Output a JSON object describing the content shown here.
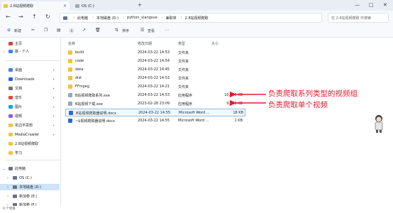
{
  "window": {
    "active_tab": "2.8站视频爬取",
    "inactive_tab": "OS (C:)",
    "controls": [
      "—",
      "□",
      "✕"
    ]
  },
  "address": {
    "crumbs": [
      "此电脑",
      "本地磁盘 (D:)",
      "python_xiangsue",
      "兼职单",
      "2.8站视频爬取"
    ],
    "search_placeholder": "在 2.8站视频爬取 中搜索"
  },
  "toolbar": {
    "new_label": "新建",
    "sort_label": "排序",
    "view_label": "查看"
  },
  "sidebar": {
    "items": [
      {
        "label": "主页",
        "color": "#e23b3b"
      },
      {
        "label": "晨 - 个人",
        "color": "#3b82f6"
      },
      {
        "label": "桌面",
        "color": "#3b82f6"
      },
      {
        "label": "Downloads",
        "color": "#2563eb"
      },
      {
        "label": "文档",
        "color": "#6b7280"
      },
      {
        "label": "音乐",
        "color": "#ef4444"
      },
      {
        "label": "图片",
        "color": "#0ea5e9"
      },
      {
        "label": "视频",
        "color": "#8b5cf6"
      },
      {
        "label": "花边平思想",
        "color": "#f5c23c"
      },
      {
        "label": "MediaCrawler",
        "color": "#f5c23c"
      },
      {
        "label": "2.8站视频爬取",
        "color": "#f5c23c"
      },
      {
        "label": "学习",
        "color": "#f5c23c"
      },
      {
        "label": "此电脑",
        "color": "#6b7280"
      },
      {
        "label": "OS (C:)",
        "color": "#6b7280"
      },
      {
        "label": "本地磁盘 (D:)",
        "color": "#6b7280"
      },
      {
        "label": "新加卷 (E:)",
        "color": "#6b7280"
      },
      {
        "label": "新加卷 (F:)",
        "color": "#6b7280"
      }
    ]
  },
  "columns": [
    "名称",
    "修改日期",
    "类型",
    "大小"
  ],
  "files": [
    {
      "name": "build",
      "date": "2024-03-22 14:53",
      "type": "文件夹",
      "size": "",
      "kind": "folder"
    },
    {
      "name": "code",
      "date": "2024-03-22 14:54",
      "type": "文件夹",
      "size": "",
      "kind": "folder"
    },
    {
      "name": "data",
      "date": "2024-03-22 14:45",
      "type": "文件夹",
      "size": "",
      "kind": "folder"
    },
    {
      "name": "dist",
      "date": "2024-03-22 14:53",
      "type": "文件夹",
      "size": "",
      "kind": "folder"
    },
    {
      "name": "FFmpeg",
      "date": "2024-03-22 14:21",
      "type": "文件夹",
      "size": "",
      "kind": "folder"
    },
    {
      "name": "B站视频爬取系列.exe",
      "date": "2024-03-22 14:53",
      "type": "应用程序",
      "size": "10,365 KB",
      "kind": "exe"
    },
    {
      "name": "B站视频下载.exe",
      "date": "2023-02-28 23:09",
      "type": "应用程序",
      "size": "9,632 KB",
      "kind": "exe"
    },
    {
      "name": "B站视频爬取器说明.docx",
      "date": "2024-03-22 14:55",
      "type": "Microsoft Word ...",
      "size": "18 KB",
      "kind": "doc"
    },
    {
      "name": "~$视频爬取器说明.docx",
      "date": "2024-03-22 14:55",
      "type": "Microsoft Word ...",
      "size": "1 KB",
      "kind": "doc"
    }
  ],
  "annotations": {
    "series": "负责爬取系列类型的视频组",
    "single": "负责爬取单个视频",
    "color": "#e11d2e"
  },
  "status": {
    "count": "9 个项目"
  }
}
